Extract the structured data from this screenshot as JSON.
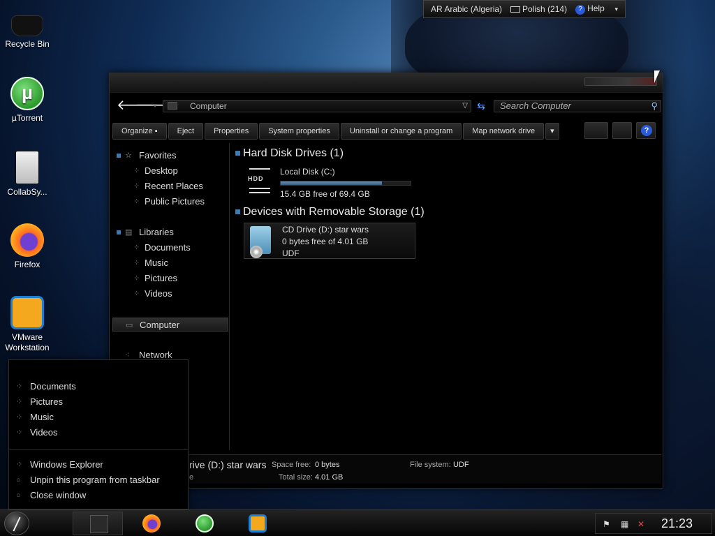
{
  "desktop": {
    "icons": [
      {
        "label": "Recycle Bin",
        "icon": "recycle-bin-icon"
      },
      {
        "label": "µTorrent",
        "icon": "utorrent-icon"
      },
      {
        "label": "CollabSy...",
        "icon": "collabsync-icon"
      },
      {
        "label": "Firefox",
        "icon": "firefox-icon"
      },
      {
        "label": "VMware Workstation",
        "icon": "vmware-icon"
      }
    ]
  },
  "language_bar": {
    "language": "AR Arabic (Algeria)",
    "keyboard": "Polish (214)",
    "help": "Help"
  },
  "explorer": {
    "address": {
      "location": "Computer"
    },
    "search": {
      "placeholder": "Search Computer"
    },
    "toolbar": {
      "organize": "Organize",
      "eject": "Eject",
      "properties": "Properties",
      "system_properties": "System properties",
      "uninstall": "Uninstall or change a program",
      "map_network_drive": "Map network drive"
    },
    "nav": {
      "favorites": "Favorites",
      "desktop": "Desktop",
      "recent_places": "Recent Places",
      "public_pictures": "Public Pictures",
      "libraries": "Libraries",
      "documents": "Documents",
      "music": "Music",
      "pictures": "Pictures",
      "videos": "Videos",
      "computer": "Computer",
      "network": "Network"
    },
    "groups": {
      "hard_disk": "Hard Disk Drives (1)",
      "removable": "Devices with Removable Storage (1)"
    },
    "local_disk": {
      "name": "Local Disk (C:)",
      "icon_label": "HDD",
      "free_text": "15.4 GB free of 69.4 GB",
      "used_fraction": 0.78
    },
    "cd_drive": {
      "name": "CD Drive (D:) star wars",
      "free_text": "0 bytes free of 4.01 GB",
      "filesystem": "UDF"
    },
    "details": {
      "title": "rive (D:) star wars",
      "subtitle": "e",
      "space_free_label": "Space free:",
      "space_free": "0 bytes",
      "total_size_label": "Total size:",
      "total_size": "4.01 GB",
      "file_system_label": "File system:",
      "file_system": "UDF"
    }
  },
  "jumplist": {
    "items": [
      "Documents",
      "Pictures",
      "Music",
      "Videos"
    ],
    "tasks": [
      "Windows Explorer",
      "Unpin this program from taskbar",
      "Close window"
    ]
  },
  "taskbar": {
    "clock": "21:23"
  }
}
